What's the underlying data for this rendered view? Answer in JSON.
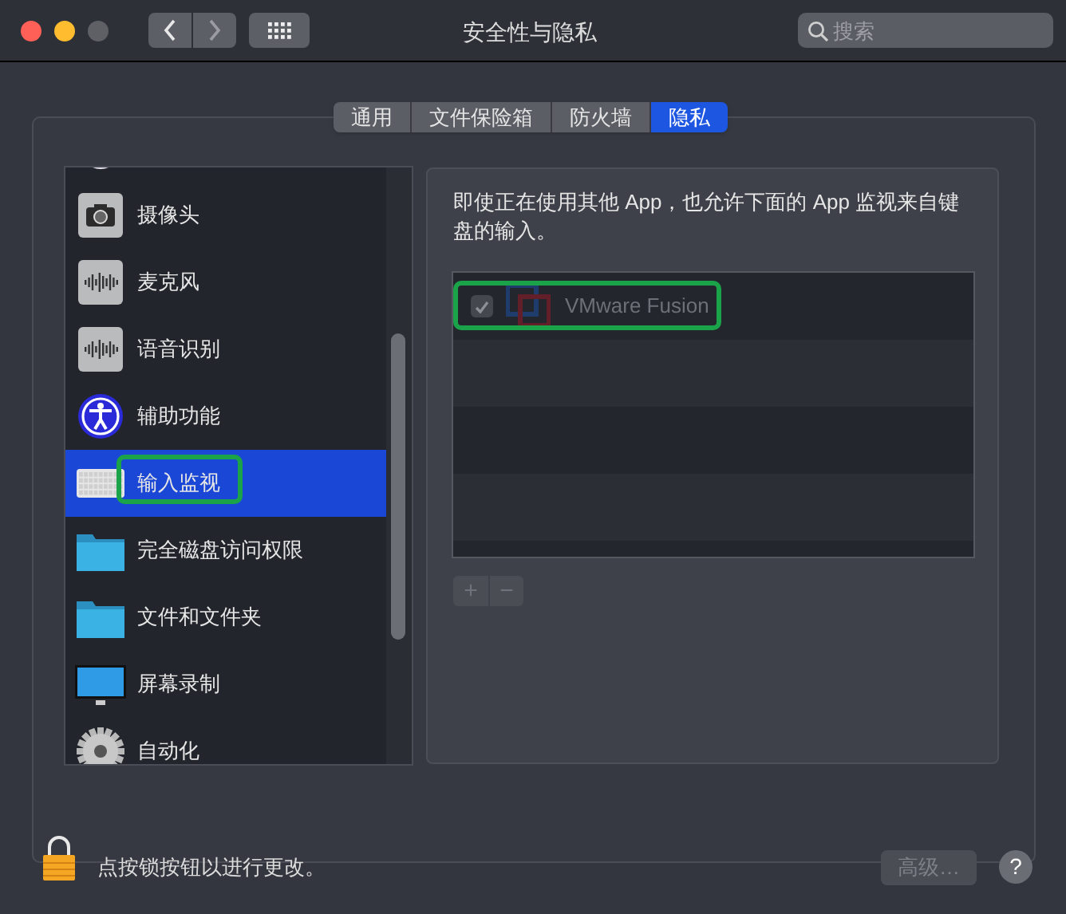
{
  "window": {
    "title": "安全性与隐私"
  },
  "search": {
    "placeholder": "搜索"
  },
  "tabs": [
    {
      "label": "通用",
      "selected": false
    },
    {
      "label": "文件保险箱",
      "selected": false
    },
    {
      "label": "防火墙",
      "selected": false
    },
    {
      "label": "隐私",
      "selected": true
    }
  ],
  "sidebar": {
    "items": [
      {
        "kind": "photos",
        "selected": false,
        "annotated": false
      },
      {
        "kind": "camera",
        "label": "摄像头",
        "selected": false,
        "annotated": false
      },
      {
        "kind": "wave",
        "label": "麦克风",
        "selected": false,
        "annotated": false
      },
      {
        "kind": "wave",
        "label": "语音识别",
        "selected": false,
        "annotated": false
      },
      {
        "kind": "accessibility",
        "label": "辅助功能",
        "selected": false,
        "annotated": false
      },
      {
        "kind": "keyboard",
        "label": "输入监视",
        "selected": true,
        "annotated": true
      },
      {
        "kind": "folder",
        "label": "完全磁盘访问权限",
        "selected": false,
        "annotated": false
      },
      {
        "kind": "folder",
        "label": "文件和文件夹",
        "selected": false,
        "annotated": false
      },
      {
        "kind": "monitor",
        "label": "屏幕录制",
        "selected": false,
        "annotated": false
      },
      {
        "kind": "gear",
        "label": "自动化",
        "selected": false,
        "annotated": false
      }
    ]
  },
  "description": "即使正在使用其他 App，也允许下面的 App 监视来自键盘的输入。",
  "apps": [
    {
      "name": "VMware Fusion",
      "checked": true,
      "disabled": true,
      "annotated": true
    }
  ],
  "list_buttons": [
    "+",
    "−"
  ],
  "footer": {
    "lock_text": "点按锁按钮以进行更改。",
    "advanced_button": {
      "label": "高级…",
      "disabled": true
    },
    "help_button": "?"
  }
}
